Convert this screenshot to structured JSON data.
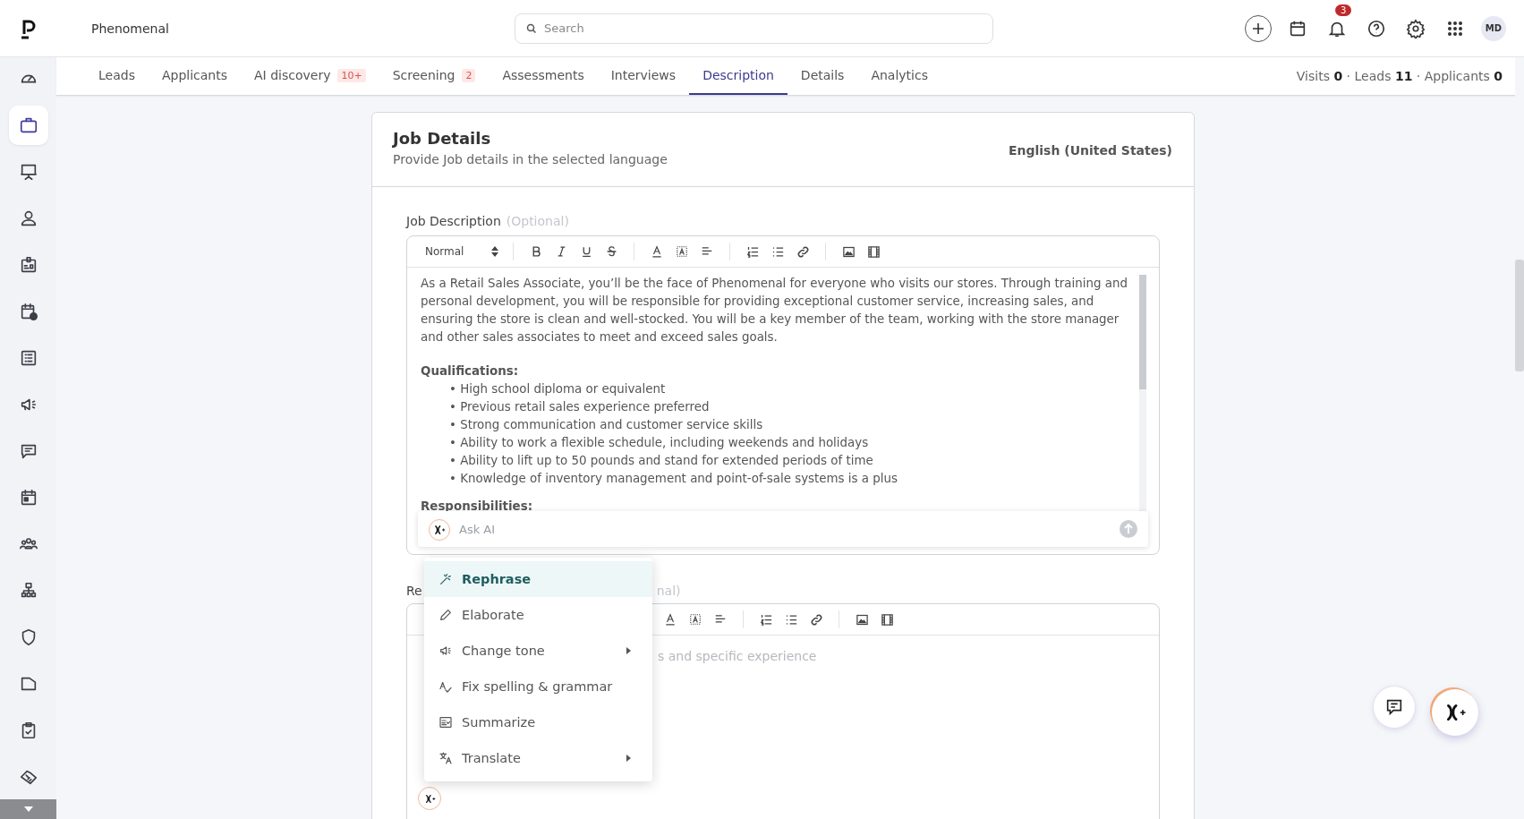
{
  "app": {
    "workspace": "Phenomenal"
  },
  "search": {
    "placeholder": "Search"
  },
  "notifications": {
    "count": "3"
  },
  "avatar": {
    "initials": "MD"
  },
  "sidebar": {
    "items": [
      {
        "selected": false
      },
      {
        "selected": true
      },
      {
        "selected": false
      },
      {
        "selected": false
      },
      {
        "selected": false
      },
      {
        "selected": false
      },
      {
        "selected": false
      },
      {
        "selected": false
      },
      {
        "selected": false
      },
      {
        "selected": false
      },
      {
        "selected": false
      },
      {
        "selected": false
      },
      {
        "selected": false
      },
      {
        "selected": false
      },
      {
        "selected": false
      },
      {
        "selected": false
      }
    ]
  },
  "tabs": [
    {
      "label": "Leads",
      "selected": false
    },
    {
      "label": "Applicants",
      "selected": false
    },
    {
      "label": "AI discovery",
      "badge": "10+",
      "selected": false
    },
    {
      "label": "Screening",
      "badge": "2",
      "selected": false
    },
    {
      "label": "Assessments",
      "selected": false
    },
    {
      "label": "Interviews",
      "selected": false
    },
    {
      "label": "Description",
      "selected": true
    },
    {
      "label": "Details",
      "selected": false
    },
    {
      "label": "Analytics",
      "selected": false
    }
  ],
  "stats": "Visits **0** · Leads **11** · Applicants **0**",
  "card": {
    "title": "Job Details",
    "subtitle": "Provide Job details in the selected language",
    "language": "English (United States)"
  },
  "job_description": {
    "label": "Job Description",
    "optional": "(Optional)",
    "format": "Normal",
    "paragraph": "As a Retail Sales Associate, you’ll be the face of Phenomenal for everyone who visits our stores. Through training and personal development, you will be responsible for providing exceptional customer service, increasing sales, and ensuring the store is clean and well-stocked. You will be a key member of the team, working with the store manager and other sales associates to meet and exceed sales goals.",
    "qualifications_heading": "Qualifications:",
    "qualifications": [
      "• High school diploma or equivalent",
      "• Previous retail sales experience preferred",
      "• Strong communication and customer service skills",
      "• Ability to work a flexible schedule, including weekends and holidays",
      "• Ability to lift up to 50 pounds and stand for extended periods of time",
      "• Knowledge of inventory management and point-of-sale systems is a plus"
    ],
    "responsibilities_heading": "Responsibilities:"
  },
  "ask_ai": {
    "placeholder": "Ask AI"
  },
  "ai_menu": [
    {
      "label": "Rephrase",
      "selected": true,
      "submenu": false
    },
    {
      "label": "Elaborate",
      "selected": false,
      "submenu": false
    },
    {
      "label": "Change tone",
      "selected": false,
      "submenu": true
    },
    {
      "label": "Fix spelling & grammar",
      "selected": false,
      "submenu": false
    },
    {
      "label": "Summarize",
      "selected": false,
      "submenu": false
    },
    {
      "label": "Translate",
      "selected": false,
      "submenu": true
    }
  ],
  "requirements": {
    "label": "Re",
    "optional": "nal)",
    "placeholder": "s and specific experience"
  }
}
